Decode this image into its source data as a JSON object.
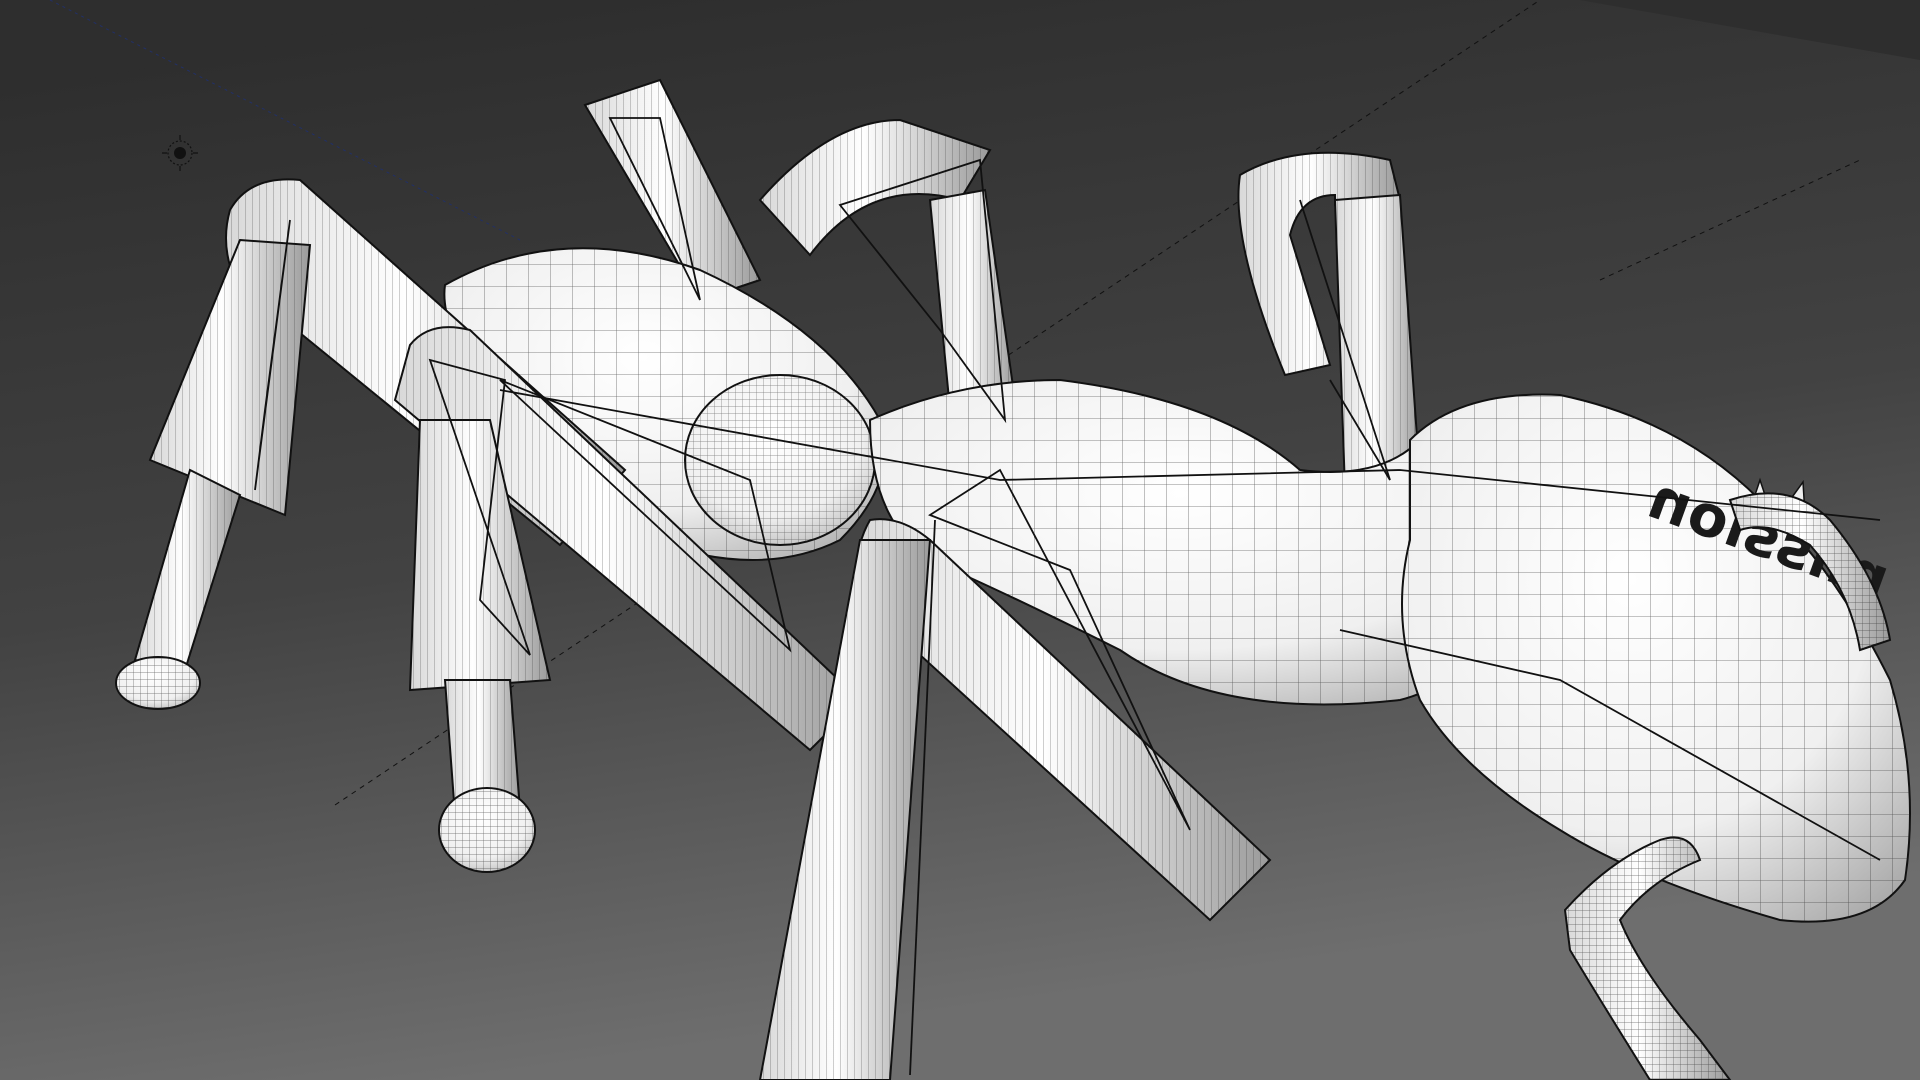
{
  "viewport": {
    "decal_text": "mission",
    "background_top": "#2d2d2d",
    "background_bottom": "#6a6a6a",
    "mesh_color": "#ffffff",
    "wire_color": "#222222"
  },
  "light_icon": "sun-light-icon"
}
